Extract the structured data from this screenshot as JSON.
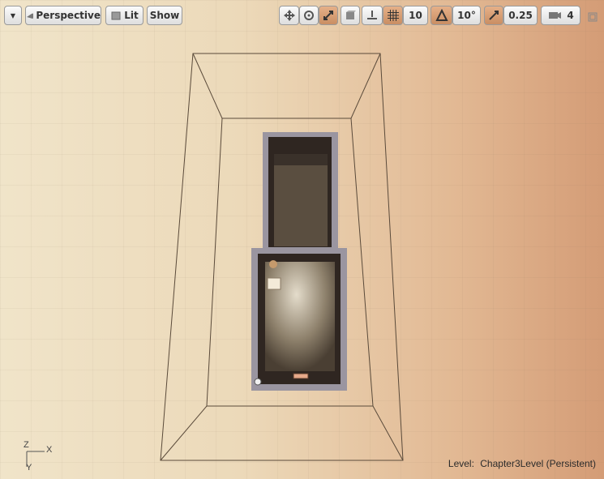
{
  "toolbar": {
    "menu_icon": "chevron-down-icon",
    "perspective_label": "Perspective",
    "lit_label": "Lit",
    "show_label": "Show",
    "grid_snap_value": "10",
    "rotation_snap_value": "10°",
    "scale_snap_value": "0.25",
    "camera_speed_value": "4"
  },
  "status": {
    "level_label": "Level:",
    "level_name": "Chapter3Level (Persistent)"
  },
  "axis": {
    "z": "Z",
    "x": "X",
    "y": "Y"
  },
  "colors": {
    "accent": "#d49c76",
    "active_button": "#c98e63"
  }
}
